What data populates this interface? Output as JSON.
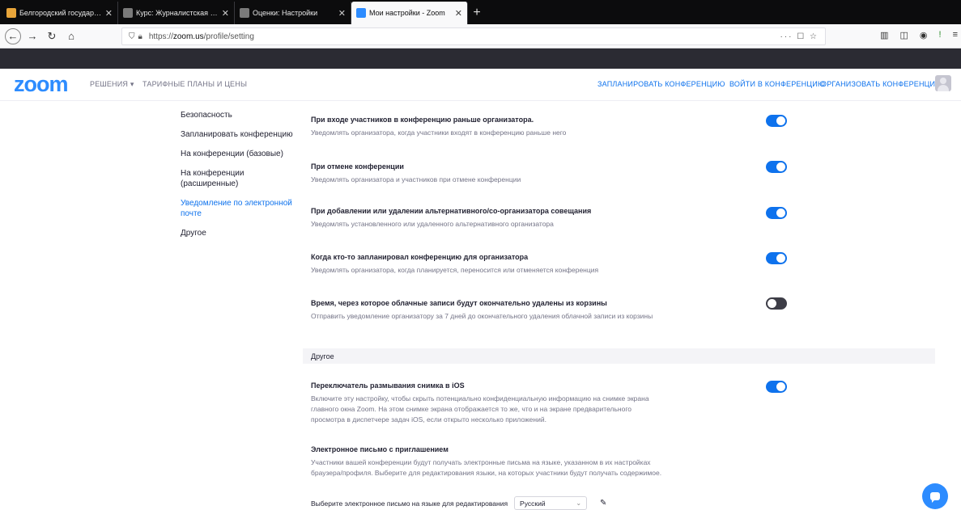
{
  "browser": {
    "tabs": [
      {
        "title": "Белгородский государственн",
        "color": "#e8a53a"
      },
      {
        "title": "Курс: Журналистская деятел",
        "color": "#7a7a7a"
      },
      {
        "title": "Оценки: Настройки",
        "color": "#7a7a7a"
      },
      {
        "title": "Мои настройки - Zoom",
        "color": "#2d8cff",
        "active": true
      }
    ],
    "new_tab": "+",
    "url_prefix": "https://",
    "url_domain": "zoom.us",
    "url_path": "/profile/setting",
    "url_right": "··· ☐ ☆"
  },
  "header": {
    "logo": "zoom",
    "nav_solutions": "РЕШЕНИЯ ▾",
    "nav_plans": "ТАРИФНЫЕ ПЛАНЫ И ЦЕНЫ",
    "nav_schedule": "ЗАПЛАНИРОВАТЬ КОНФЕРЕНЦИЮ",
    "nav_join": "ВОЙТИ В КОНФЕРЕНЦИЮ",
    "nav_host": "ОРГАНИЗОВАТЬ КОНФЕРЕНЦИЮ ▾"
  },
  "submenu": {
    "items": [
      "Безопасность",
      "Запланировать конференцию",
      "На конференции (базовые)",
      "На конференции (расширенные)",
      "Уведомление по электронной почте",
      "Другое"
    ],
    "active_index": 4
  },
  "settings": [
    {
      "title": "При входе участников в конференцию раньше организатора.",
      "desc": "Уведомлять организатора, когда участники входят в конференцию раньше него",
      "on": true
    },
    {
      "title": "При отмене конференции",
      "desc": "Уведомлять организатора и участников при отмене конференции",
      "on": true
    },
    {
      "title": "При добавлении или удалении альтернативного/со-организатора совещания",
      "desc": "Уведомлять установленного или удаленного альтернативного организатора",
      "on": true
    },
    {
      "title": "Когда кто-то запланировал конференцию для организатора",
      "desc": "Уведомлять организатора, когда планируется, переносится или отменяется конференция",
      "on": true
    },
    {
      "title": "Время, через которое облачные записи будут окончательно удалены из корзины",
      "desc": "Отправить уведомление организатору за 7 дней до окончательного удаления облачной записи из корзины",
      "on": false
    }
  ],
  "other_section": {
    "header": "Другое",
    "ios_title": "Переключатель размывания снимка в iOS",
    "ios_desc": "Включите эту настройку, чтобы скрыть потенциально конфиденциальную информацию на снимке экрана главного окна Zoom. На этом снимке экрана отображается то же, что и на экране предварительного просмотра в диспетчере задач iOS, если открыто несколько приложений.",
    "ios_on": true,
    "invite_title": "Электронное письмо с приглашением",
    "invite_desc": "Участники вашей конференции будут получать электронные письма на языке, указанном в их настройках браузера/профиля. Выберите для редактирования языки, на которых участники будут получать содержимое.",
    "lang_label": "Выберите электронное письмо на языке для редактирования",
    "lang_value": "Русский"
  },
  "colors": {
    "accent": "#0e72ed",
    "logo": "#2d8cff",
    "toggle_off": "#3d3d47"
  }
}
